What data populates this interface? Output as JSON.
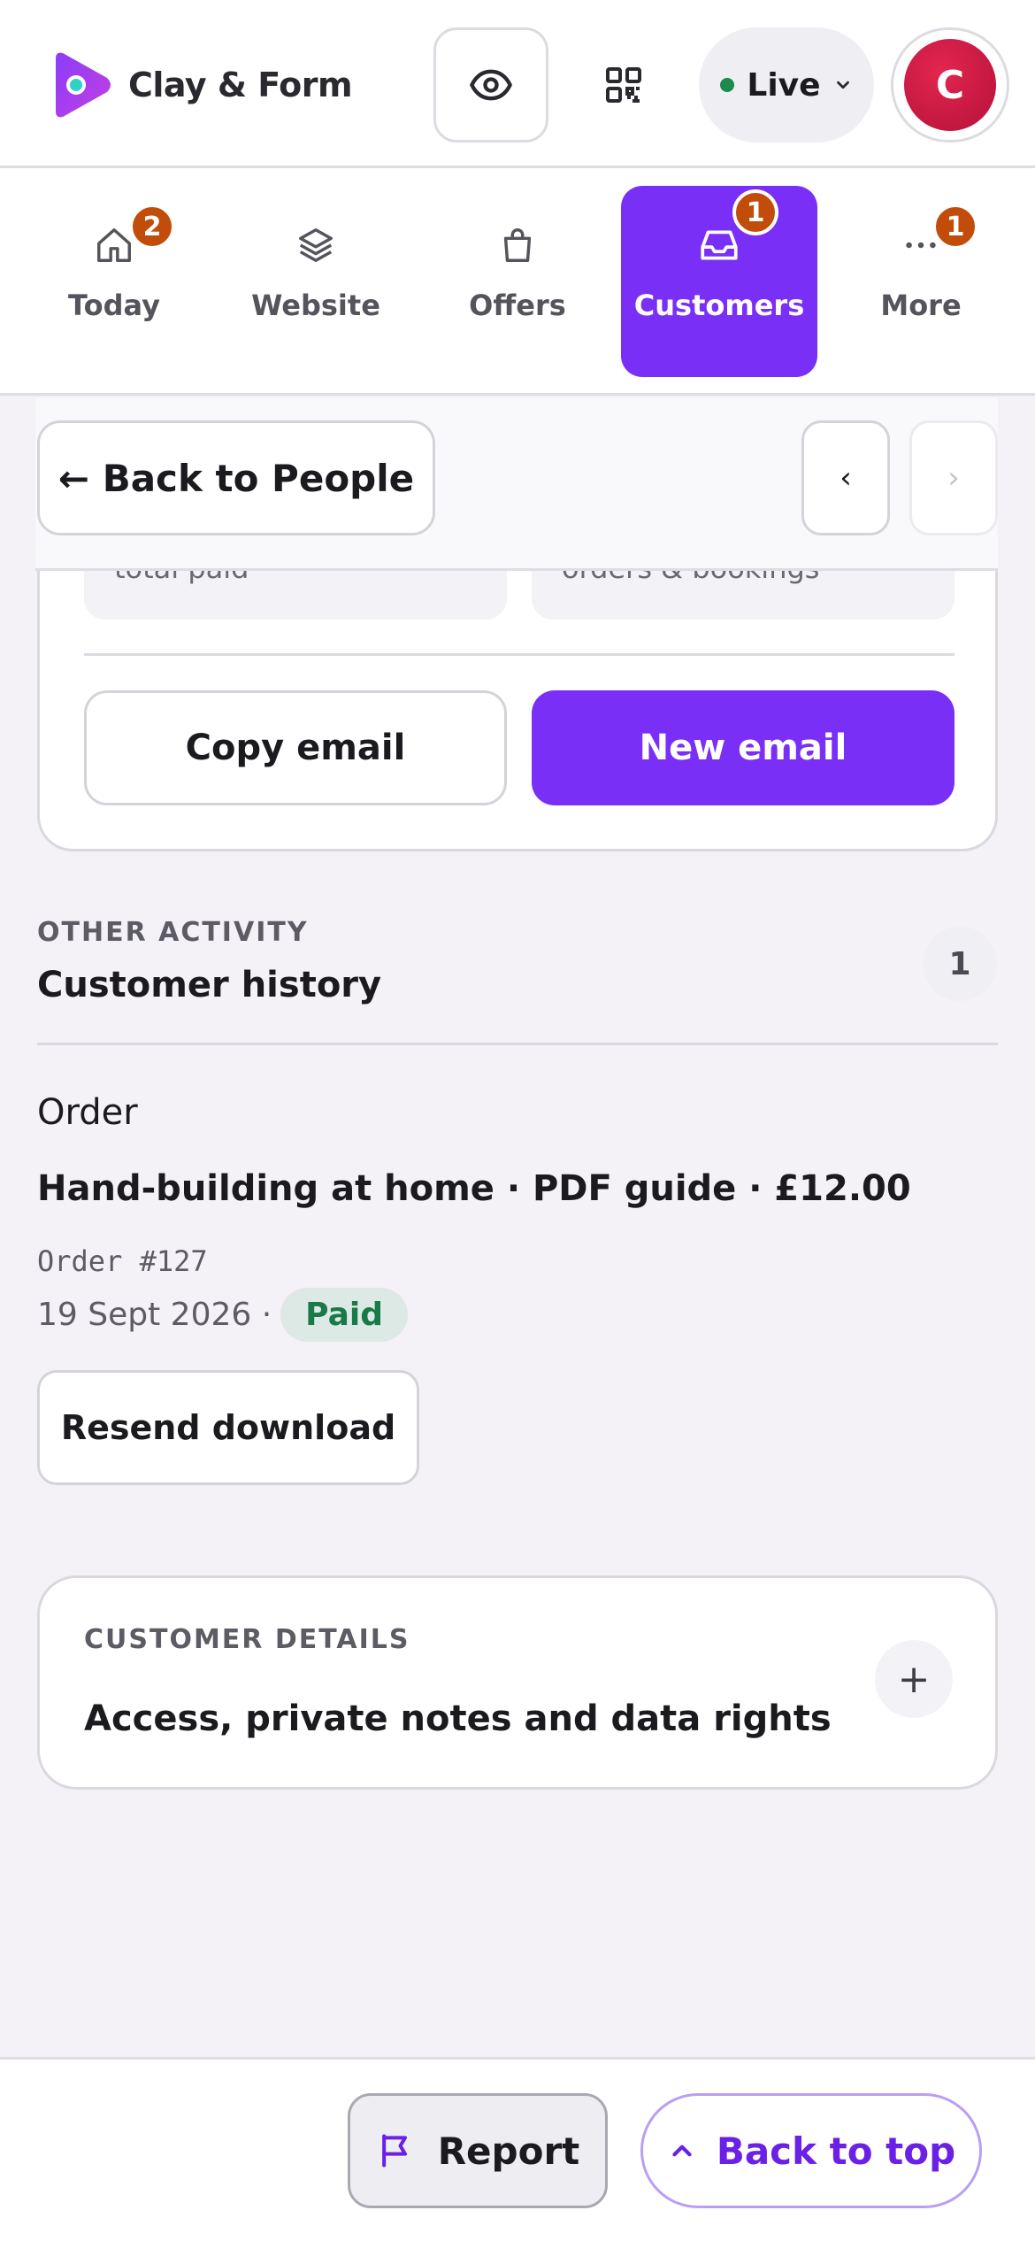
{
  "header": {
    "brand_name": "Clay & Form",
    "status_label": "Live",
    "avatar_initial": "C",
    "colors": {
      "accent": "#7a2ff7",
      "live_dot": "#1a8a4e",
      "avatar": "#d41f47"
    }
  },
  "nav": {
    "items": [
      {
        "label": "Today",
        "icon": "home-icon",
        "badge": "2"
      },
      {
        "label": "Website",
        "icon": "layers-icon",
        "badge": ""
      },
      {
        "label": "Offers",
        "icon": "shopping-bag-icon",
        "badge": ""
      },
      {
        "label": "Customers",
        "icon": "inbox-icon",
        "badge": "1",
        "active": true
      },
      {
        "label": "More",
        "icon": "more-dots-icon",
        "badge": "1"
      }
    ]
  },
  "backrow": {
    "back_label": "← Back to People",
    "prev_glyph": "‹",
    "next_glyph": "›"
  },
  "customer_card": {
    "stat_1_caption": "total paid",
    "stat_2_caption": "orders & bookings",
    "copy_email_label": "Copy email",
    "new_email_label": "New email"
  },
  "history": {
    "eyebrow": "OTHER ACTIVITY",
    "title": "Customer history",
    "count": "1",
    "order": {
      "type": "Order",
      "title": "Hand-building at home · PDF guide · £12.00",
      "number": "Order #127",
      "date": "19 Sept 2026 ·",
      "status": "Paid",
      "action_label": "Resend download"
    }
  },
  "details": {
    "eyebrow": "CUSTOMER DETAILS",
    "title": "Access, private notes and data rights",
    "toggle_glyph": "+"
  },
  "bottombar": {
    "report_label": "Report",
    "back_to_top_label": "Back to top"
  }
}
